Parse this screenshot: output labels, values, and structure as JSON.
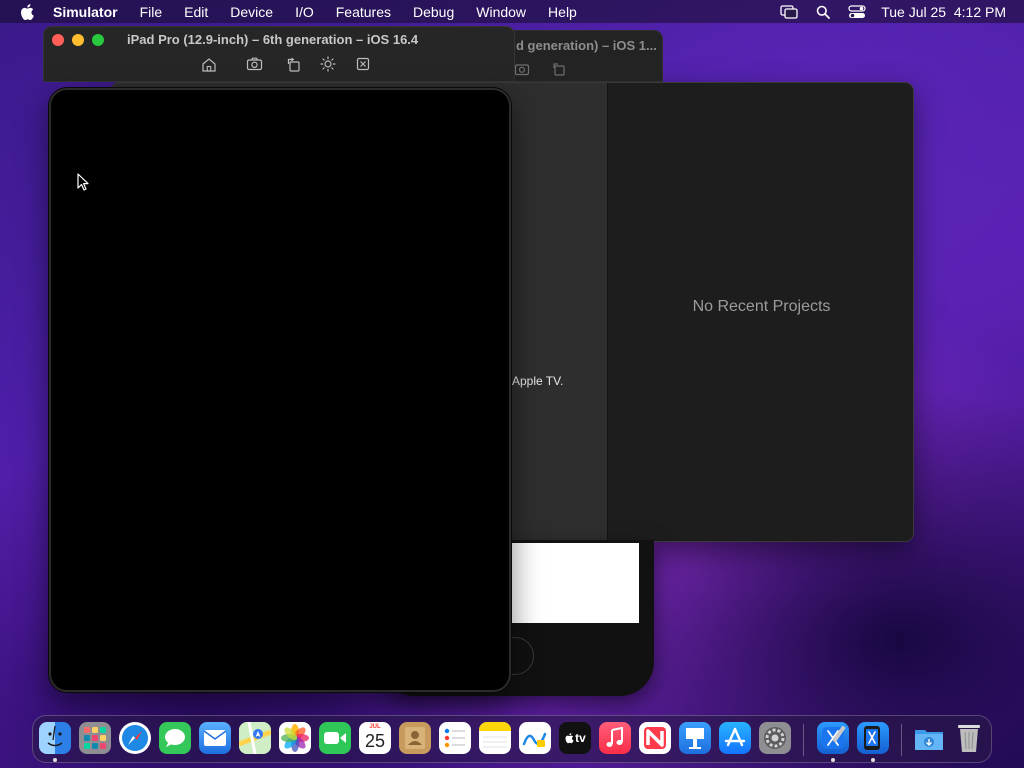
{
  "menubar": {
    "app_name": "Simulator",
    "items": [
      "File",
      "Edit",
      "Device",
      "I/O",
      "Features",
      "Debug",
      "Window",
      "Help"
    ],
    "clock": "Tue Jul 25  4:12 PM",
    "status_icons": [
      "screen-mirroring-icon",
      "spotlight-search-icon",
      "control-center-icon"
    ]
  },
  "simulator_front": {
    "title": "iPad Pro (12.9-inch) – 6th generation – iOS 16.4",
    "toolbar": [
      "home-icon",
      "screenshot-icon",
      "rotate-icon",
      "appearance-icon",
      "close-device-icon"
    ]
  },
  "simulator_back": {
    "title": "d generation) – iOS 1..."
  },
  "welcome_window": {
    "empty_label": "No Recent Projects",
    "peek_text": "Apple TV."
  },
  "dock": {
    "apps": [
      {
        "name": "Finder",
        "icon": "finder-icon",
        "color": "#3a8ef2"
      },
      {
        "name": "Launchpad",
        "icon": "launchpad-icon",
        "color": "#8e8e93"
      },
      {
        "name": "Safari",
        "icon": "safari-icon",
        "color": "#1e88e5"
      },
      {
        "name": "Messages",
        "icon": "messages-icon",
        "color": "#34c759"
      },
      {
        "name": "Mail",
        "icon": "mail-icon",
        "color": "#2f80ed"
      },
      {
        "name": "Maps",
        "icon": "maps-icon",
        "color": "#5ac85a"
      },
      {
        "name": "Photos",
        "icon": "photos-icon",
        "color": "#ffffff"
      },
      {
        "name": "FaceTime",
        "icon": "facetime-icon",
        "color": "#30c759"
      },
      {
        "name": "Calendar",
        "icon": "calendar-icon",
        "color": "#ffffff"
      },
      {
        "name": "Contacts",
        "icon": "contacts-icon",
        "color": "#c79a5e"
      },
      {
        "name": "Reminders",
        "icon": "reminders-icon",
        "color": "#ffffff"
      },
      {
        "name": "Notes",
        "icon": "notes-icon",
        "color": "#ffd60a"
      },
      {
        "name": "Freeform",
        "icon": "freeform-icon",
        "color": "#ffffff"
      },
      {
        "name": "TV",
        "icon": "tv-icon",
        "color": "#111111"
      },
      {
        "name": "Music",
        "icon": "music-icon",
        "color": "#fa2d48"
      },
      {
        "name": "News",
        "icon": "news-icon",
        "color": "#ffffff"
      },
      {
        "name": "Keynote",
        "icon": "keynote-icon",
        "color": "#1e90ff"
      },
      {
        "name": "App Store",
        "icon": "app-store-icon",
        "color": "#1a8cff"
      },
      {
        "name": "System Settings",
        "icon": "settings-icon",
        "color": "#8e8e93"
      },
      {
        "name": "Xcode",
        "icon": "xcode-icon",
        "color": "#1c7fe8"
      },
      {
        "name": "Simulator",
        "icon": "simulator-icon",
        "color": "#1c7fe8"
      },
      {
        "name": "Downloads",
        "icon": "downloads-folder-icon",
        "color": "#4aa8f0"
      },
      {
        "name": "Trash",
        "icon": "trash-icon",
        "color": "#c9c9c9"
      }
    ],
    "calendar_month": "JUL",
    "calendar_day": "25",
    "tv_label": "tv"
  }
}
